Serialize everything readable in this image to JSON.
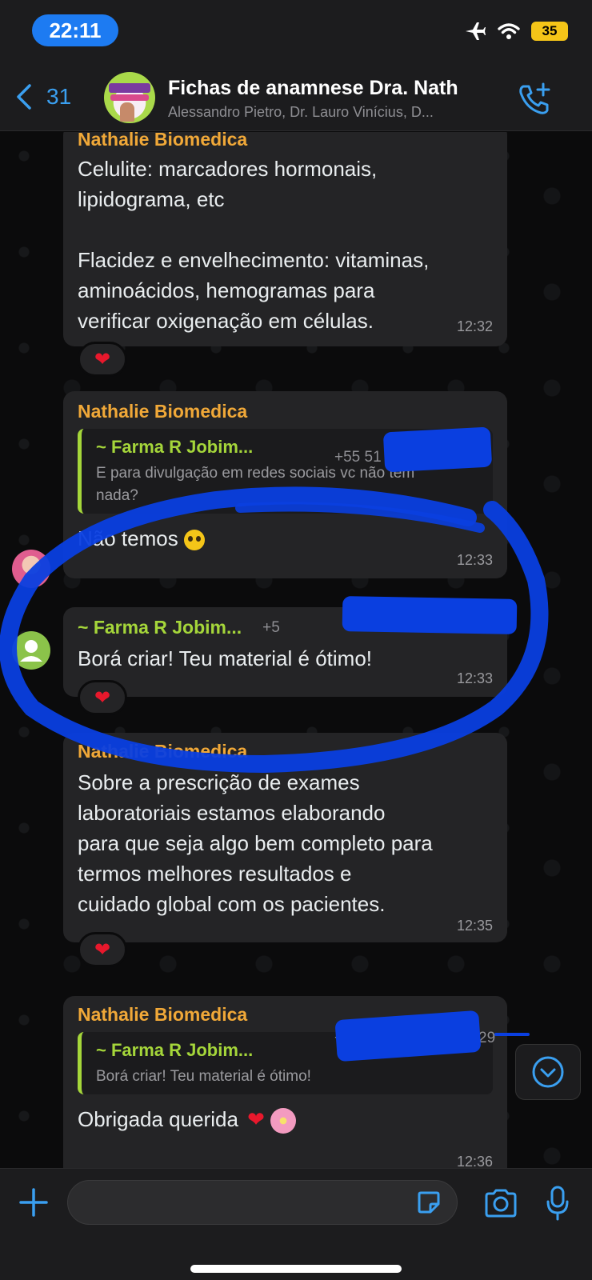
{
  "status_bar": {
    "time": "22:11",
    "battery": "35"
  },
  "header": {
    "back_count": "31",
    "title": "Fichas de anamnese Dra. Nath",
    "subtitle": "Alessandro Pietro, Dr. Lauro Vinícius, D..."
  },
  "messages": [
    {
      "sender": "Nathalie Biomedica",
      "lines": [
        "Celulite: marcadores hormonais,",
        "lipidograma, etc",
        "",
        "Flacidez e envelhecimento: vitaminas,",
        "aminoácidos, hemogramas para",
        "verificar oxigenação em células."
      ],
      "time": "12:32",
      "reaction": "❤"
    },
    {
      "sender": "Nathalie Biomedica",
      "quote": {
        "name": "~ Farma R Jobim...",
        "phone": "+55 51 98",
        "text_lines": [
          "E para divulgação em redes sociais vc não tem",
          "nada?"
        ]
      },
      "text": "Não temos",
      "time": "12:33"
    },
    {
      "sender": "~ Farma R Jobim...",
      "phone": "+5",
      "text": "Borá criar! Teu material é ótimo!",
      "time": "12:33",
      "reaction": "❤"
    },
    {
      "sender": "Nathalie Biomedica",
      "lines": [
        "Sobre a prescrição de exames",
        "laboratoriais estamos elaborando",
        "para que seja algo bem completo para",
        "termos melhores resultados e",
        "cuidado global com os pacientes."
      ],
      "time": "12:35",
      "reaction": "❤"
    },
    {
      "sender": "Nathalie Biomedica",
      "quote": {
        "name": "~ Farma R Jobim...",
        "phone": "+5",
        "phone_tail": "29",
        "text": "Borá criar! Teu material é ótimo!"
      },
      "text": "Obrigada querida",
      "time": "12:36"
    }
  ],
  "colors": {
    "accent_blue": "#3a9ff0",
    "sender_orange": "#f0a838",
    "quote_green": "#a5d63a",
    "highlight_blue": "#0a3fe0"
  }
}
